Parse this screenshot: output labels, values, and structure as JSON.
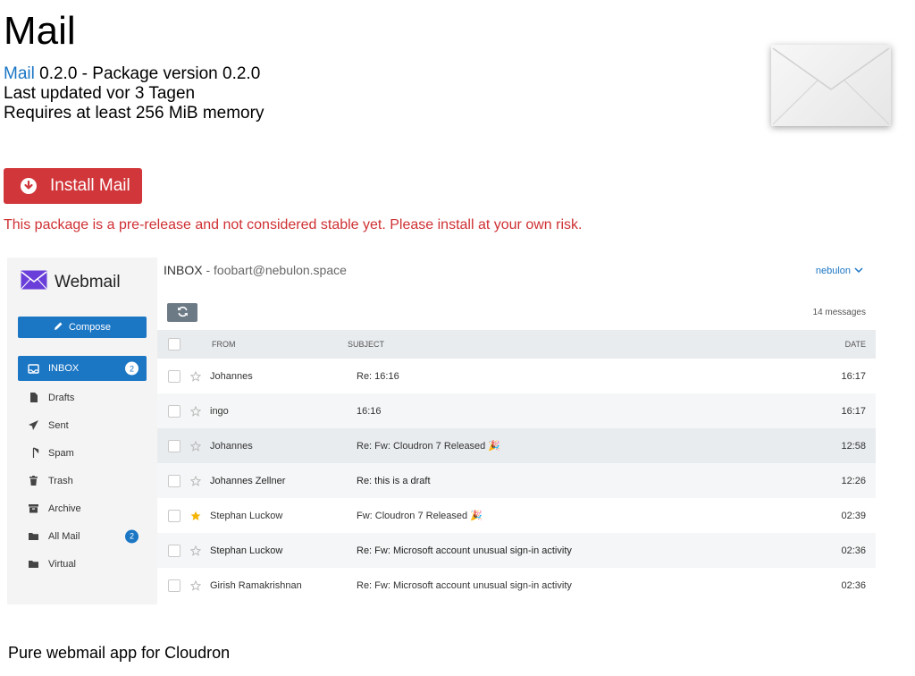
{
  "app": {
    "title": "Mail",
    "link_label": "Mail",
    "version_text": " 0.2.0 - Package version 0.2.0",
    "last_updated": "Last updated vor 3 Tagen",
    "memory": "Requires at least 256 MiB memory",
    "install_label": "Install Mail",
    "warning": "This package is a pre-release and not considered stable yet. Please install at your own risk.",
    "description": "Pure webmail app for Cloudron"
  },
  "colors": {
    "accent": "#1b76c4",
    "danger": "#d1363a",
    "warning_text": "#cf3033",
    "star": "#f5b400"
  },
  "webmail": {
    "brand": "Webmail",
    "compose_label": "Compose",
    "header_mailbox": "INBOX",
    "header_sep": " - ",
    "header_address": "foobart@nebulon.space",
    "user": "nebulon",
    "message_count": "14 messages",
    "columns": {
      "from": "FROM",
      "subject": "SUBJECT",
      "date": "DATE"
    },
    "nav": [
      {
        "label": "INBOX",
        "icon": "inbox-icon",
        "badge": "2",
        "active": true
      },
      {
        "label": "Drafts",
        "icon": "file-icon",
        "badge": "",
        "active": false
      },
      {
        "label": "Sent",
        "icon": "paper-plane-icon",
        "badge": "",
        "active": false
      },
      {
        "label": "Spam",
        "icon": "shield-icon",
        "badge": "",
        "active": false
      },
      {
        "label": "Trash",
        "icon": "trash-icon",
        "badge": "",
        "active": false
      },
      {
        "label": "Archive",
        "icon": "archive-icon",
        "badge": "",
        "active": false
      },
      {
        "label": "All Mail",
        "icon": "folder-icon",
        "badge": "2",
        "active": false
      },
      {
        "label": "Virtual",
        "icon": "folder-icon",
        "badge": "",
        "active": false
      }
    ],
    "messages": [
      {
        "from": "Johannes",
        "subject": "Re: 16:16",
        "date": "16:17",
        "starred": false,
        "unread": false
      },
      {
        "from": "ingo",
        "subject": "16:16",
        "date": "16:17",
        "starred": false,
        "unread": false
      },
      {
        "from": "Johannes",
        "subject": "Re: Fw: Cloudron 7 Released 🎉",
        "date": "12:58",
        "starred": false,
        "unread": false
      },
      {
        "from": "Johannes Zellner",
        "subject": "Re: this is a draft",
        "date": "12:26",
        "starred": false,
        "unread": true
      },
      {
        "from": "Stephan Luckow",
        "subject": "Fw: Cloudron 7 Released 🎉",
        "date": "02:39",
        "starred": true,
        "unread": false
      },
      {
        "from": "Stephan Luckow",
        "subject": "Re: Fw: Microsoft account unusual sign-in activity",
        "date": "02:36",
        "starred": false,
        "unread": true
      },
      {
        "from": "Girish Ramakrishnan",
        "subject": "Re: Fw: Microsoft account unusual sign-in activity",
        "date": "02:36",
        "starred": false,
        "unread": false
      }
    ]
  }
}
